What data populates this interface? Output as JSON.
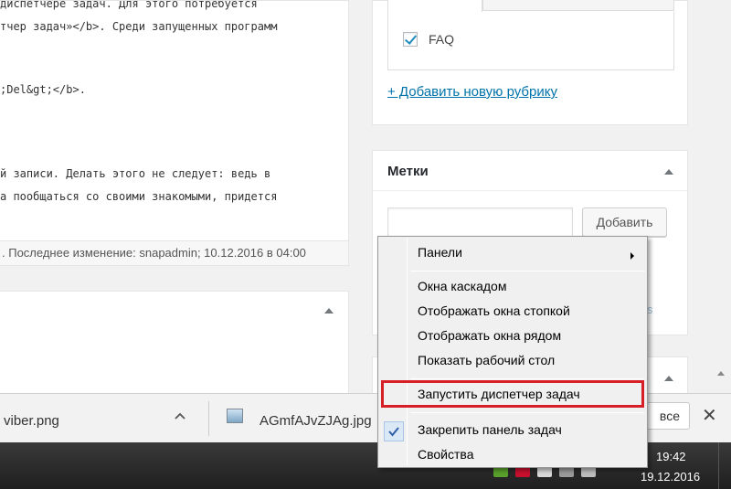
{
  "editor": {
    "lines": [
      "диспетчере задач. Для этого потребуется",
      "тчер задач»</b>. Среди запущенных программ",
      "",
      ";Del&gt;</b>.",
      "",
      "",
      "й записи. Делать этого не следует: ведь в",
      "а пообщаться со своими знакомыми, придется"
    ],
    "status": ". Последнее изменение: snapadmin; 10.12.2016 в 04:00"
  },
  "categories": {
    "item_label": "FAQ",
    "add_link": "+ Добавить новую рубрику"
  },
  "tags": {
    "title": "Метки",
    "add_button": "Добавить",
    "faded_text": "s"
  },
  "downloads": {
    "file1": "viber.png",
    "file2": "AGmfAJvZJAg.jpg",
    "show_all": "все",
    "close": "✕"
  },
  "taskbar": {
    "time": "19:42",
    "date": "19.12.2016"
  },
  "context_menu": {
    "items": [
      {
        "label": "Панели",
        "submenu": true
      },
      {
        "label": "Окна каскадом"
      },
      {
        "label": "Отображать окна стопкой"
      },
      {
        "label": "Отображать окна рядом"
      },
      {
        "label": "Показать рабочий стол"
      },
      {
        "label": "Запустить диспетчер задач",
        "highlighted": true
      },
      {
        "label": "Закрепить панель задач",
        "checked": true
      },
      {
        "label": "Свойства"
      }
    ]
  },
  "colors": {
    "link": "#0073aa",
    "highlight_border": "#d61f26",
    "checkbox_tick": "#1e8cbe"
  }
}
